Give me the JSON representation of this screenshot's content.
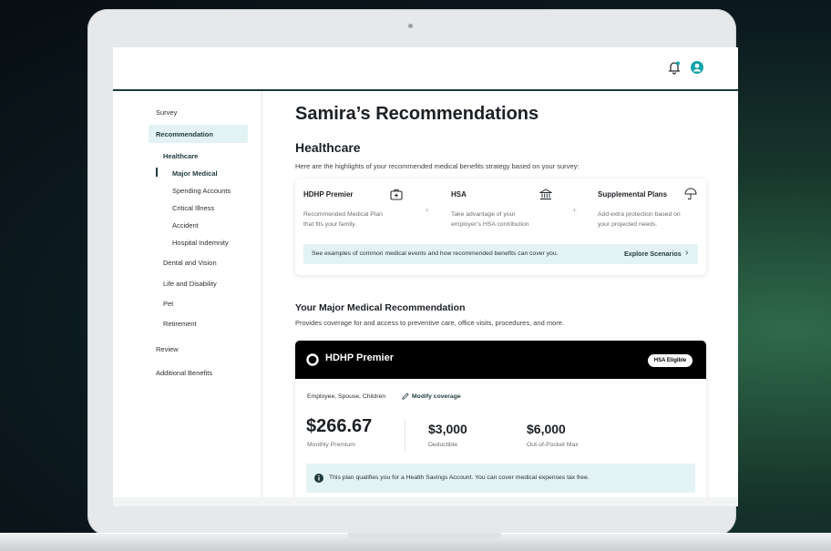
{
  "sidebar": {
    "items": [
      {
        "label": "Survey"
      },
      {
        "label": "Recommendation"
      },
      {
        "label": "Healthcare"
      },
      {
        "label": "Major Medical"
      },
      {
        "label": "Spending Accounts"
      },
      {
        "label": "Critical Illness"
      },
      {
        "label": "Accident"
      },
      {
        "label": "Hospital Indemnity"
      },
      {
        "label": "Dental and Vision"
      },
      {
        "label": "Life and Disability"
      },
      {
        "label": "Pet"
      },
      {
        "label": "Retirement"
      },
      {
        "label": "Review"
      },
      {
        "label": "Additional Benefits"
      }
    ]
  },
  "page": {
    "title": "Samira’s Recommendations",
    "section_title": "Healthcare",
    "section_subtitle": "Here are the highlights of your recommended medical benefits strategy based on your survey:"
  },
  "highlights": {
    "items": [
      {
        "title": "HDHP Premier",
        "desc_line1": "Recommended Medical Plan",
        "desc_line2": "that fits your family.",
        "icon": "medical-card-icon"
      },
      {
        "title": "HSA",
        "desc_line1": "Take advantage of your",
        "desc_line2": "employer’s HSA contribution",
        "icon": "bank-icon"
      },
      {
        "title": "Supplemental Plans",
        "desc_line1": "Add extra protection based on",
        "desc_line2": "your projected needs.",
        "icon": "umbrella-icon"
      }
    ],
    "plus": "+",
    "banner_text": "See examples of common medical events and how recommended benefits can cover you.",
    "banner_link": "Explore Scenarios",
    "banner_chevron": "›"
  },
  "major_medical": {
    "title": "Your Major Medical Recommendation",
    "subtitle": "Provides coverage for and access to preventive care, office visits, procedures, and more.",
    "plan_name": "HDHP Premier",
    "badge": "HSA Eligible",
    "coverage": "Employee, Spouse, Children",
    "modify_label": "Modify coverage",
    "premium_value": "$266.67",
    "premium_label": "Monthly Premium",
    "deductible_value": "$3,000",
    "deductible_label": "Deductible",
    "oop_value": "$6,000",
    "oop_label": "Out-of-Pocket Max",
    "info_text": "This plan qualifies you for a Health Savings Account. You can cover medical expenses tax free."
  },
  "colors": {
    "accent": "#1f3a3d",
    "teal_bg": "#e3f3f3",
    "teal_icon": "#14a3a8",
    "plan_header": "#000000"
  }
}
